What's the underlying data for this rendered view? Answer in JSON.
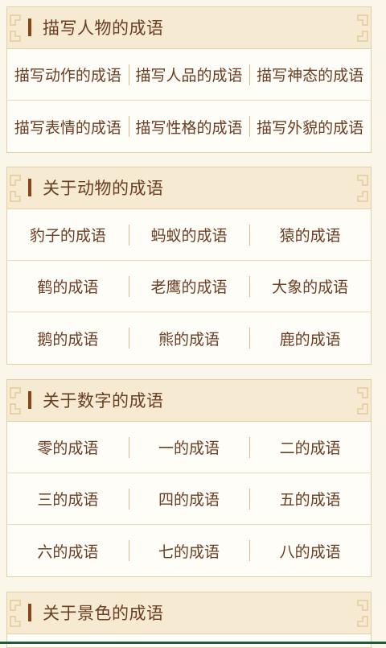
{
  "sections": [
    {
      "title": "描写人物的成语",
      "rows": [
        [
          "描写动作的成语",
          "描写人品的成语",
          "描写神态的成语"
        ],
        [
          "描写表情的成语",
          "描写性格的成语",
          "描写外貌的成语"
        ]
      ]
    },
    {
      "title": "关于动物的成语",
      "rows": [
        [
          "豹子的成语",
          "蚂蚁的成语",
          "猿的成语"
        ],
        [
          "鹤的成语",
          "老鹰的成语",
          "大象的成语"
        ],
        [
          "鹅的成语",
          "熊的成语",
          "鹿的成语"
        ]
      ]
    },
    {
      "title": "关于数字的成语",
      "rows": [
        [
          "零的成语",
          "一的成语",
          "二的成语"
        ],
        [
          "三的成语",
          "四的成语",
          "五的成语"
        ],
        [
          "六的成语",
          "七的成语",
          "八的成语"
        ]
      ]
    },
    {
      "title": "关于景色的成语",
      "rows": []
    }
  ],
  "colors": {
    "accent": "#8b4513",
    "text": "#6b3d22",
    "header_bg": "#f6ebd2",
    "border": "#e2cfa6"
  }
}
